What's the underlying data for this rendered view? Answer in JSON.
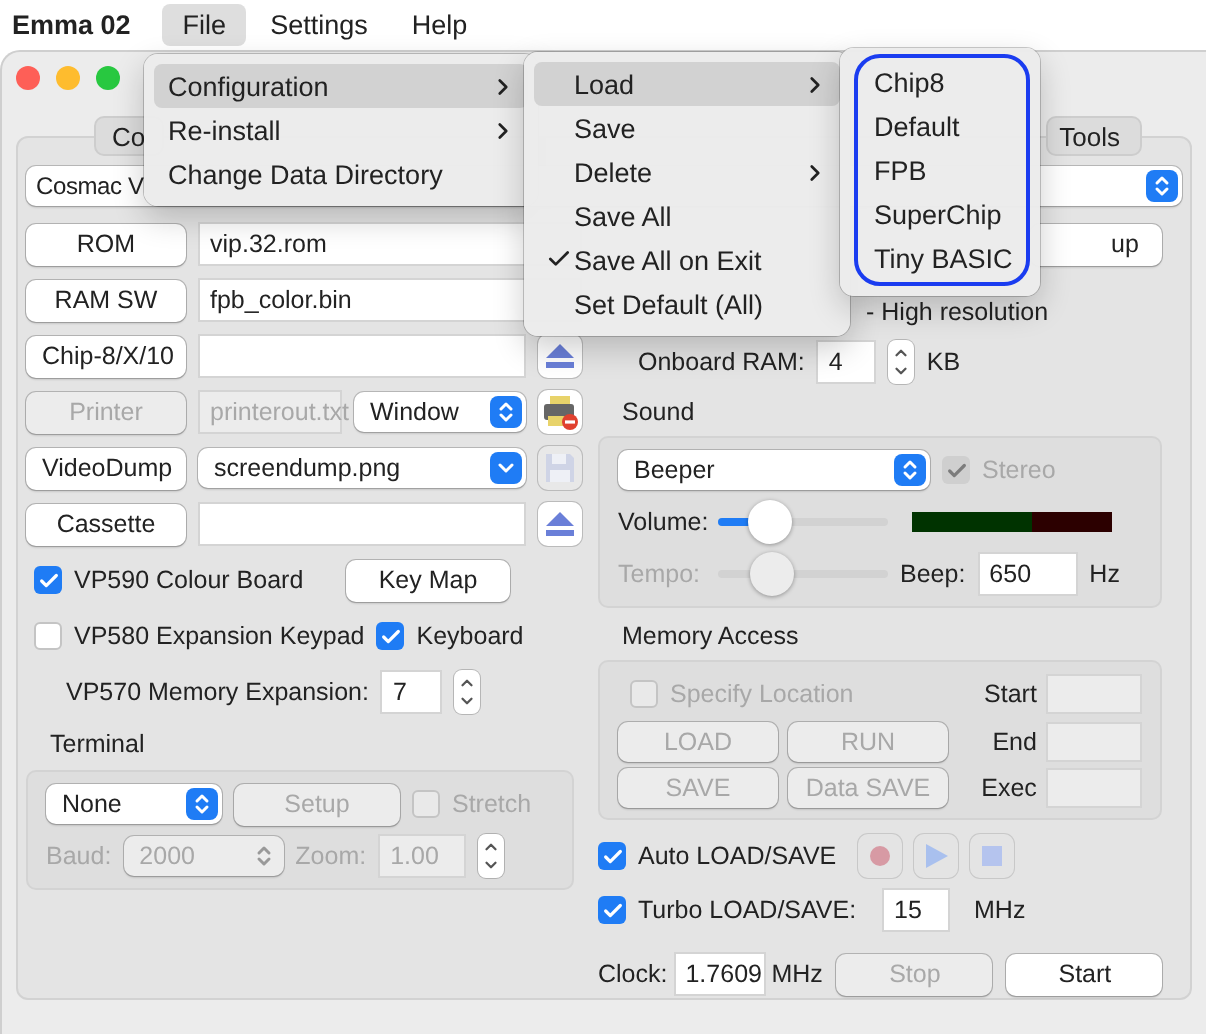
{
  "menubar": {
    "app_name": "Emma 02",
    "menus": [
      {
        "label": "File",
        "selected": true
      },
      {
        "label": "Settings",
        "selected": false
      },
      {
        "label": "Help",
        "selected": false
      }
    ]
  },
  "file_menu": {
    "items": [
      {
        "label": "Configuration",
        "submenu": true,
        "selected": true
      },
      {
        "label": "Re-install",
        "submenu": true,
        "selected": false
      },
      {
        "label": "Change Data Directory",
        "submenu": false,
        "selected": false
      }
    ]
  },
  "configuration_menu": {
    "items": [
      {
        "label": "Load",
        "submenu": true,
        "checked": false,
        "selected": true
      },
      {
        "label": "Save",
        "submenu": false,
        "checked": false,
        "selected": false
      },
      {
        "label": "Delete",
        "submenu": true,
        "checked": false,
        "selected": false
      },
      {
        "label": "Save All",
        "submenu": false,
        "checked": false,
        "selected": false
      },
      {
        "label": "Save All on Exit",
        "submenu": false,
        "checked": true,
        "selected": false
      },
      {
        "label": "Set Default (All)",
        "submenu": false,
        "checked": false,
        "selected": false
      }
    ]
  },
  "load_menu": {
    "outlined": true,
    "items": [
      {
        "label": "Chip8"
      },
      {
        "label": "Default"
      },
      {
        "label": "FPB"
      },
      {
        "label": "SuperChip"
      },
      {
        "label": "Tiny BASIC"
      }
    ]
  },
  "window": {
    "tabs": [
      {
        "label": "Co",
        "selected": false
      },
      {
        "label": "Tools",
        "selected": false
      }
    ],
    "machine_select": {
      "value": "Cosmac V"
    },
    "file_rows": [
      {
        "kind": "file",
        "button": "ROM",
        "value": "vip.32.rom",
        "disabled": false
      },
      {
        "kind": "file",
        "button": "RAM SW",
        "value": "fpb_color.bin",
        "disabled": false
      },
      {
        "kind": "eject",
        "button": "Chip-8/X/10",
        "disabled": false
      },
      {
        "kind": "printer",
        "button": "Printer",
        "value": "printerout.txt",
        "mode": "Window",
        "disabled": true
      },
      {
        "kind": "combo",
        "button": "VideoDump",
        "value": "screendump.png",
        "disabled": false
      },
      {
        "kind": "eject",
        "button": "Cassette",
        "disabled": false
      }
    ],
    "vp590": {
      "label": "VP590 Colour Board",
      "checked": true
    },
    "key_map_button": "Key Map",
    "vp580": {
      "label": "VP580 Expansion Keypad",
      "checked": false
    },
    "keyboard": {
      "label": "Keyboard",
      "checked": true
    },
    "memory_expansion": {
      "label": "VP570 Memory Expansion:",
      "value": "7"
    },
    "terminal": {
      "title": "Terminal",
      "type": "None",
      "setup_button": "Setup",
      "disabled": true,
      "stretch": {
        "label": "Stretch",
        "checked": false
      },
      "baud_label": "Baud:",
      "baud": "2000",
      "zoom_label": "Zoom:",
      "zoom": "1.00"
    },
    "setup_button": "up",
    "resolution_text": "- High resolution",
    "onboard_ram": {
      "label": "Onboard RAM:",
      "value": "4",
      "unit": "KB"
    },
    "sound": {
      "title": "Sound",
      "type": "Beeper",
      "stereo": {
        "label": "Stereo",
        "checked": true,
        "disabled": true
      },
      "volume": {
        "label": "Volume:",
        "level": 0.3,
        "disabled": false
      },
      "tempo": {
        "label": "Tempo:",
        "level": 0.32,
        "disabled": true
      },
      "beep": {
        "label": "Beep:",
        "value": "650",
        "unit": "Hz"
      }
    },
    "memory_access": {
      "title": "Memory Access",
      "disabled": true,
      "specify": {
        "label": "Specify Location",
        "checked": false
      },
      "buttons": [
        "LOAD",
        "RUN",
        "SAVE",
        "Data SAVE"
      ],
      "fields": [
        {
          "label": "Start"
        },
        {
          "label": "End"
        },
        {
          "label": "Exec"
        }
      ]
    },
    "auto_load_save": {
      "label": "Auto LOAD/SAVE",
      "checked": true
    },
    "turbo": {
      "label": "Turbo LOAD/SAVE:",
      "checked": true,
      "value": "15",
      "unit": "MHz"
    },
    "clock": {
      "label": "Clock:",
      "value": "1.7609",
      "unit": "MHz"
    },
    "stop_button": {
      "label": "Stop",
      "disabled": true
    },
    "start_button": {
      "label": "Start",
      "disabled": false
    }
  }
}
